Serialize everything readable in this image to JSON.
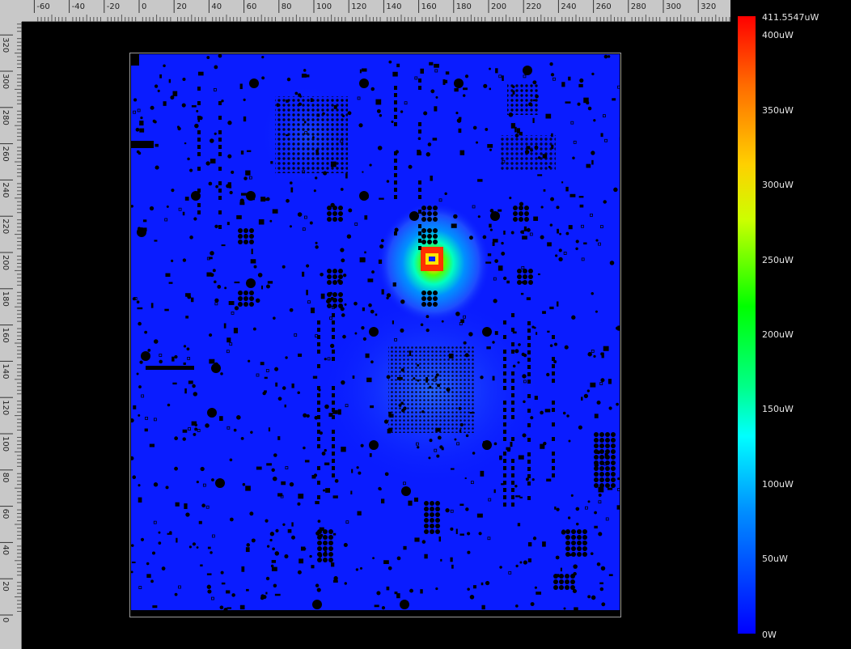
{
  "ruler": {
    "top_ticks": [
      "-60",
      "-40",
      "-20",
      "0",
      "20",
      "40",
      "60",
      "80",
      "100",
      "120",
      "140",
      "160",
      "180",
      "200",
      "220",
      "240",
      "260",
      "280",
      "300",
      "320"
    ],
    "left_ticks": [
      "320",
      "300",
      "280",
      "260",
      "240",
      "220",
      "200",
      "180",
      "160",
      "140",
      "120",
      "100",
      "80",
      "60",
      "40",
      "20",
      "0"
    ]
  },
  "legend": {
    "max": "411.5547uW",
    "labels": [
      "400uW",
      "350uW",
      "300uW",
      "250uW",
      "200uW",
      "150uW",
      "100uW",
      "50uW",
      "0W"
    ]
  },
  "colors": {
    "board_base": "#0a1cff",
    "hotspot": "#ff3000",
    "components": "#000000"
  },
  "map": {
    "quantity": "power dissipation",
    "unit": "uW",
    "peak_value": 411.5547,
    "hotspot_location": "upper-center component"
  }
}
